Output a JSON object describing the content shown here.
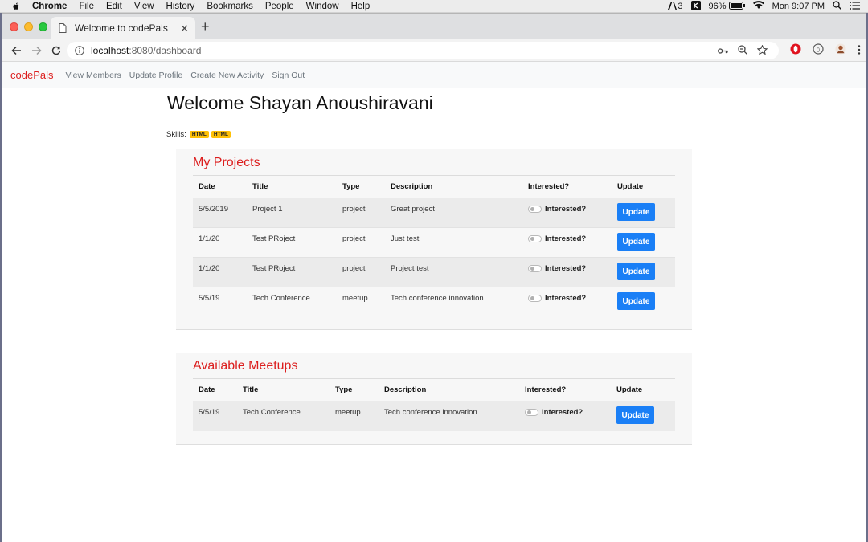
{
  "menubar": {
    "app": "Chrome",
    "items": [
      "File",
      "Edit",
      "View",
      "History",
      "Bookmarks",
      "People",
      "Window",
      "Help"
    ],
    "notif_count": "3",
    "battery": "96%",
    "clock": "Mon 9:07 PM"
  },
  "browser": {
    "tab_title": "Welcome to codePals",
    "url_host": "localhost",
    "url_path": ":8080/dashboard"
  },
  "nav": {
    "brand": "codePals",
    "links": [
      "View Members",
      "Update Profile",
      "Create New Activity",
      "Sign Out"
    ]
  },
  "profile": {
    "welcome": "Welcome Shayan Anoushiravani",
    "skills_label": "Skills:",
    "skills": [
      "HTML",
      "HTML"
    ]
  },
  "projects": {
    "title": "My Projects",
    "headers": [
      "Date",
      "Title",
      "Type",
      "Description",
      "Interested?",
      "Update"
    ],
    "rows": [
      {
        "date": "5/5/2019",
        "title": "Project 1",
        "type": "project",
        "description": "Great project",
        "interested": "Interested?",
        "update": "Update"
      },
      {
        "date": "1/1/20",
        "title": "Test PRoject",
        "type": "project",
        "description": "Just test",
        "interested": "Interested?",
        "update": "Update"
      },
      {
        "date": "1/1/20",
        "title": "Test PRoject",
        "type": "project",
        "description": "Project test",
        "interested": "Interested?",
        "update": "Update"
      },
      {
        "date": "5/5/19",
        "title": "Tech Conference",
        "type": "meetup",
        "description": "Tech conference innovation",
        "interested": "Interested?",
        "update": "Update"
      }
    ]
  },
  "meetups": {
    "title": "Available Meetups",
    "headers": [
      "Date",
      "Title",
      "Type",
      "Description",
      "Interested?",
      "Update"
    ],
    "rows": [
      {
        "date": "5/5/19",
        "title": "Tech Conference",
        "type": "meetup",
        "description": "Tech conference innovation",
        "interested": "Interested?",
        "update": "Update"
      }
    ]
  },
  "colors": {
    "brand": "#dc1e1e",
    "button": "#1a7ff6",
    "badge": "#ffc107"
  }
}
